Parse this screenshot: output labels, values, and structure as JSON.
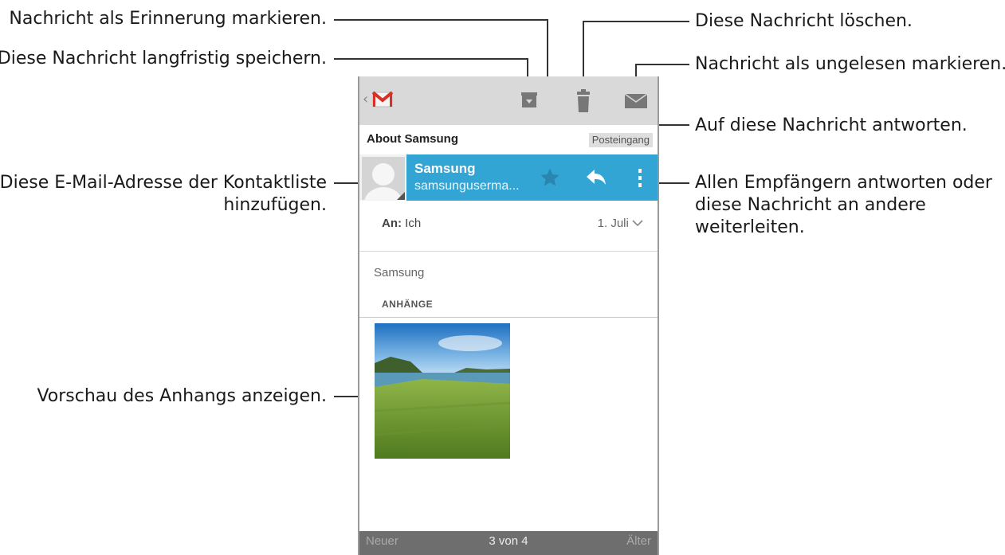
{
  "callouts": {
    "reminder": "Nachricht als Erinnerung markieren.",
    "archive": "Diese Nachricht langfristig speichern.",
    "add_contact_1": "Diese E-Mail-Adresse der Kontaktliste",
    "add_contact_2": "hinzufügen.",
    "preview": "Vorschau des Anhangs anzeigen.",
    "delete": "Diese Nachricht löschen.",
    "unread": "Nachricht als ungelesen markieren.",
    "reply": "Auf diese Nachricht antworten.",
    "more_1": "Allen Empfängern antworten oder",
    "more_2": "diese Nachricht an andere",
    "more_3": "weiterleiten."
  },
  "actionbar": {
    "back_glyph": "‹",
    "icons": [
      "gmail-logo-icon",
      "archive-icon",
      "trash-icon",
      "envelope-icon"
    ]
  },
  "email": {
    "subject": "About Samsung",
    "folder": "Posteingang",
    "sender_name": "Samsung",
    "sender_email": "samsunguserma...",
    "to_label": "An:",
    "to_value": "Ich",
    "date": "1. Juli",
    "body": "Samsung",
    "attachments_heading": "ANHÄNGE"
  },
  "bottombar": {
    "newer": "Neuer",
    "position": "3 von 4",
    "older": "Älter"
  },
  "colors": {
    "sender_bar": "#33a5d4",
    "actionbar": "#d9d9d9",
    "bottombar": "#6e6e6e"
  }
}
